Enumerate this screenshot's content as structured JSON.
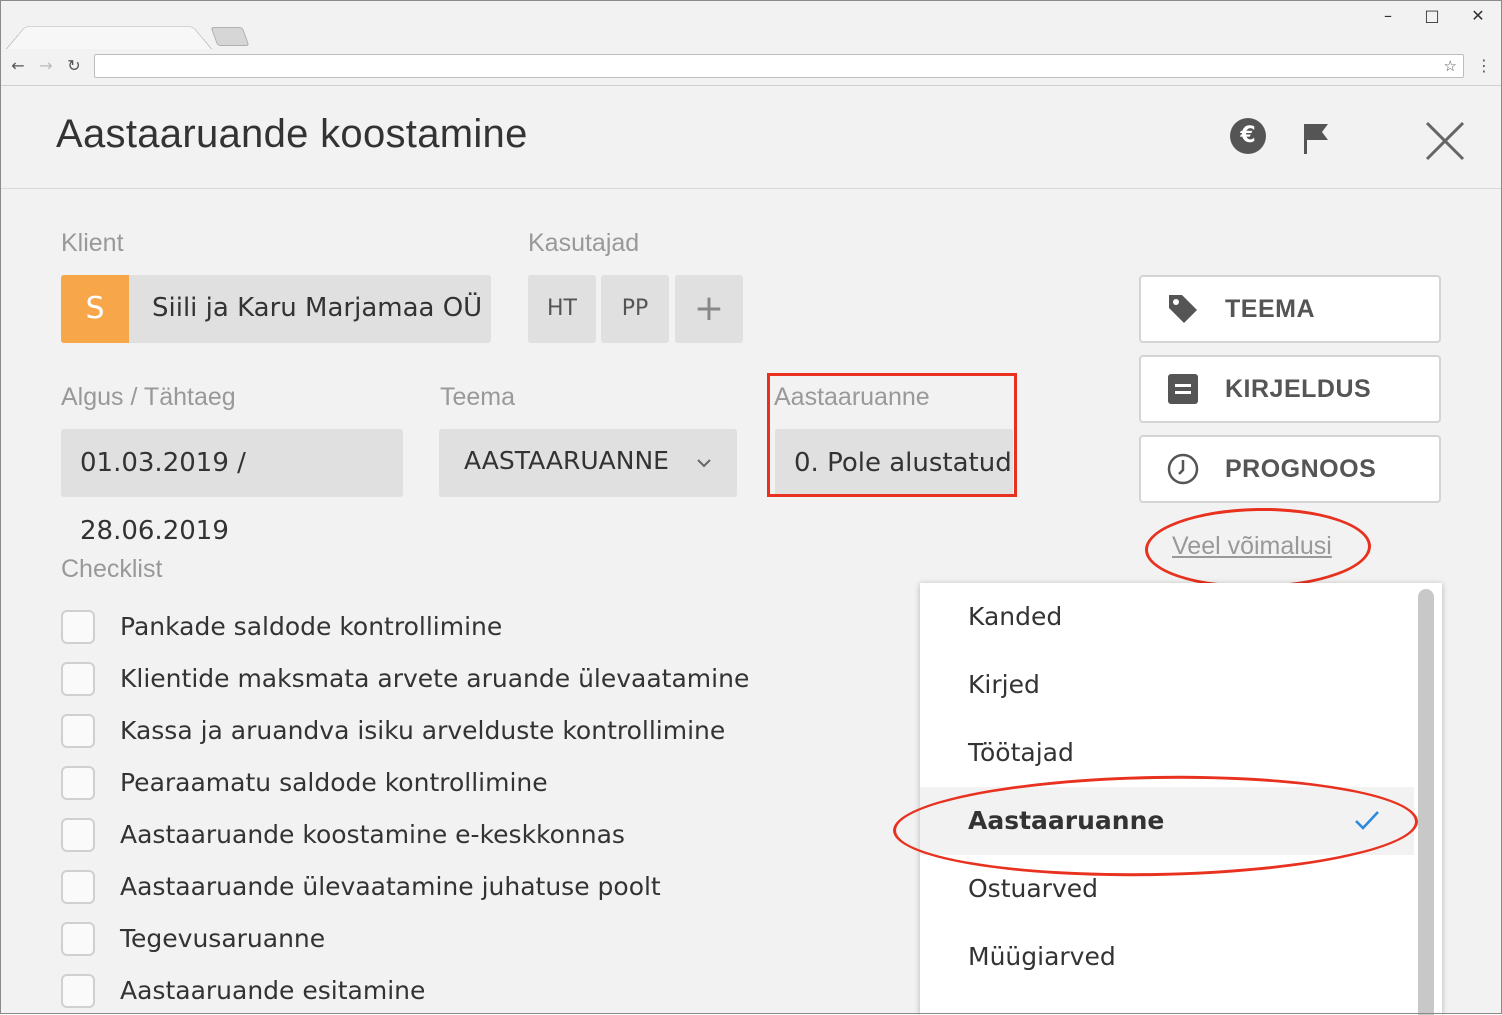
{
  "dialog": {
    "title": "Aastaaruande koostamine",
    "header_icons": {
      "euro": "€",
      "flag": "flag-icon",
      "close": "close-icon"
    }
  },
  "client": {
    "label": "Klient",
    "avatar_letter": "S",
    "avatar_color": "#f7a64a",
    "name": "Siili ja Karu Marjamaa OÜ"
  },
  "users": {
    "label": "Kasutajad",
    "chips": [
      "HT",
      "PP"
    ],
    "add_symbol": "+"
  },
  "dates": {
    "label": "Algus / Tähtaeg",
    "value": "01.03.2019 / 28.06.2019"
  },
  "theme": {
    "label": "Teema",
    "value": "AASTAARUANNE"
  },
  "status": {
    "label": "Aastaaruanne",
    "value": "0. Pole alustatud"
  },
  "actions": {
    "teema": "TEEMA",
    "kirjeldus": "KIRJELDUS",
    "prognoos": "PROGNOOS",
    "more_link": "Veel võimalusi"
  },
  "checklist": {
    "label": "Checklist",
    "items": [
      "Pankade saldode kontrollimine",
      "Klientide maksmata arvete aruande ülevaatamine",
      "Kassa ja aruandva isiku arvelduste kontrollimine",
      "Pearaamatu saldode kontrollimine",
      "Aastaaruande koostamine e-keskkonnas",
      "Aastaaruande ülevaatamine juhatuse poolt",
      "Tegevusaruanne",
      "Aastaaruande esitamine"
    ]
  },
  "dropdown": {
    "items": [
      "Kanded",
      "Kirjed",
      "Töötajad",
      "Aastaaruanne",
      "Ostuarved",
      "Müügiarved"
    ],
    "selected": "Aastaaruanne",
    "check_color": "#2b8ae0"
  },
  "annotation_color": "#e8311e"
}
